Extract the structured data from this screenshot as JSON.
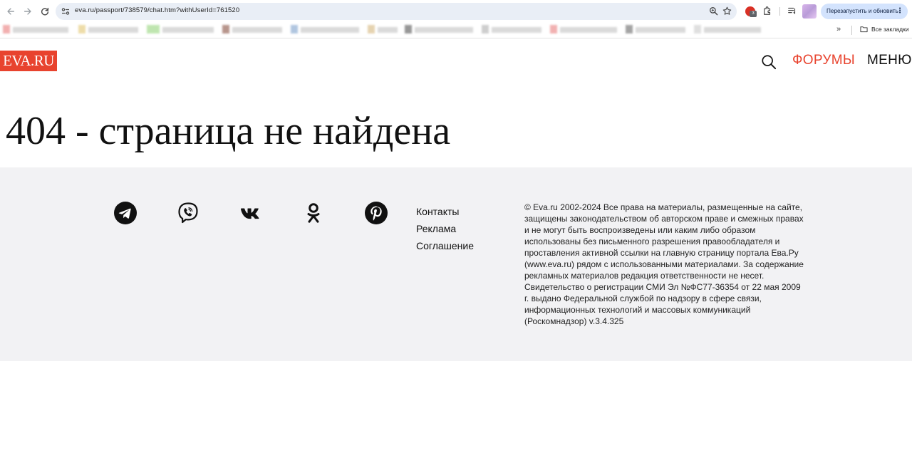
{
  "browser": {
    "url": "eva.ru/passport/738579/chat.htm?withUserId=761520",
    "extension_badge": "3",
    "restart_label": "Перезапустить и обновить",
    "bookmarks_more": "»",
    "all_bookmarks_label": "Все закладки"
  },
  "header": {
    "logo_text": "EVA.RU",
    "forums_label": "ФОРУМЫ",
    "menu_label": "МЕНЮ"
  },
  "main": {
    "title": "404 - страница не найдена"
  },
  "footer": {
    "social": [
      "telegram-icon",
      "viber-icon",
      "vk-icon",
      "odnoklassniki-icon",
      "pinterest-icon"
    ],
    "links": [
      "Контакты",
      "Реклама",
      "Соглашение"
    ],
    "copyright": "© Eva.ru 2002-2024 Все права на материалы, размещенные на сайте, защищены законодательством об авторском праве и смежных правах и не могут быть воспроизведены или каким либо образом использованы без письменного разрешения правообладателя и проставления активной ссылки на главную страницу портала Ева.Ру (www.eva.ru) рядом с использованными материалами. За содержание рекламных материалов редакция ответственности не несет. Свидетельство о регистрации СМИ Эл №ФС77-36354 от 22 мая 2009 г. выдано Федеральной службой по надзору в сфере связи, информационных технологий и массовых коммуникаций (Роскомнадзор) v.3.4.325"
  },
  "colors": {
    "brand_red": "#e8432e",
    "footer_bg": "#f2f2f4",
    "omnibox_bg": "#e9eef6",
    "restart_btn_bg": "#d3e3fd"
  }
}
